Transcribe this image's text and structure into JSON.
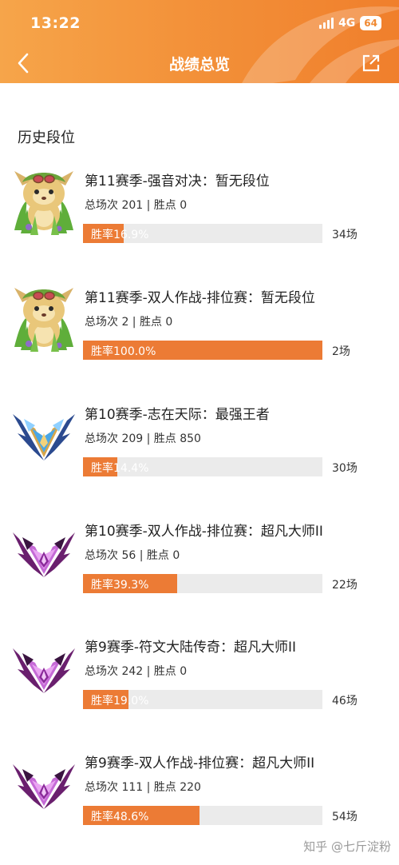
{
  "status_bar": {
    "time": "13:22",
    "network": "4G",
    "battery": "64"
  },
  "nav": {
    "title": "战绩总览"
  },
  "section": {
    "title": "历史段位"
  },
  "records": [
    {
      "badge": "teemo-badge",
      "title": "第11赛季-强音对决：暂无段位",
      "stats": "总场次 201 | 胜点 0",
      "win_rate_label": "胜率16.9%",
      "win_rate": 0.169,
      "games": "34场"
    },
    {
      "badge": "teemo-badge",
      "title": "第11赛季-双人作战-排位赛：暂无段位",
      "stats": "总场次 2 | 胜点 0",
      "win_rate_label": "胜率100.0%",
      "win_rate": 1.0,
      "games": "2场"
    },
    {
      "badge": "challenger-badge",
      "title": "第10赛季-志在天际：最强王者",
      "stats": "总场次 209 | 胜点 850",
      "win_rate_label": "胜率14.4%",
      "win_rate": 0.144,
      "games": "30场"
    },
    {
      "badge": "master-badge",
      "title": "第10赛季-双人作战-排位赛：超凡大师II",
      "stats": "总场次 56 | 胜点 0",
      "win_rate_label": "胜率39.3%",
      "win_rate": 0.393,
      "games": "22场"
    },
    {
      "badge": "master-badge",
      "title": "第9赛季-符文大陆传奇：超凡大师II",
      "stats": "总场次 242 | 胜点 0",
      "win_rate_label": "胜率19.0%",
      "win_rate": 0.19,
      "games": "46场"
    },
    {
      "badge": "master-badge",
      "title": "第9赛季-双人作战-排位赛：超凡大师II",
      "stats": "总场次 111 | 胜点 220",
      "win_rate_label": "胜率48.6%",
      "win_rate": 0.486,
      "games": "54场"
    }
  ],
  "colors": {
    "accent": "#ec7b35",
    "track": "#ebebeb",
    "header_start": "#f6a54a",
    "header_end": "#f07f2c"
  },
  "watermark": "知乎 @七斤淀粉"
}
